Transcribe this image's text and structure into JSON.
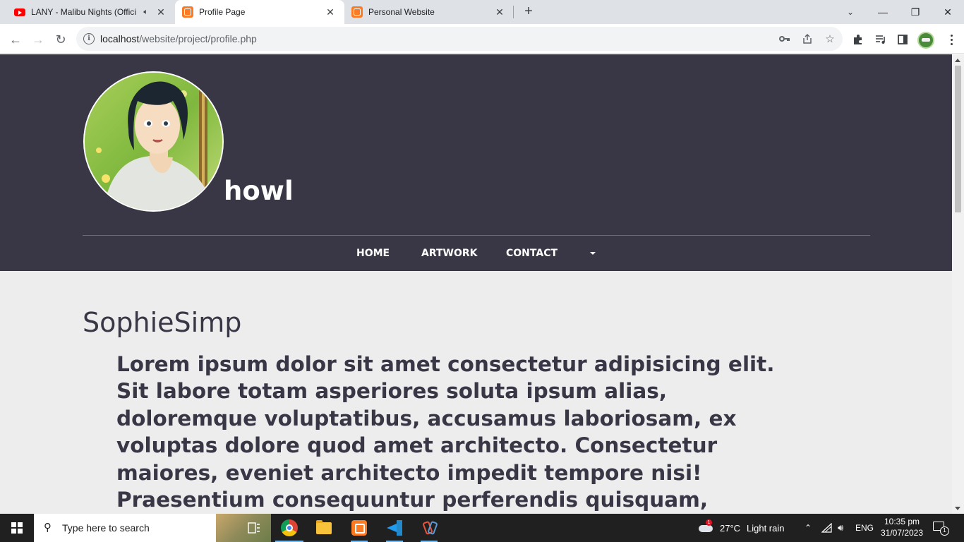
{
  "browser": {
    "tabs": [
      {
        "title": "LANY - Malibu Nights (Offici",
        "favicon": "youtube-icon",
        "audio": true,
        "active": false
      },
      {
        "title": "Profile Page",
        "favicon": "xampp-icon",
        "audio": false,
        "active": true
      },
      {
        "title": "Personal Website",
        "favicon": "xampp-icon",
        "audio": false,
        "active": false
      }
    ],
    "new_tab_symbol": "+",
    "close_symbol": "✕",
    "address": {
      "host": "localhost",
      "path": "/website/project/profile.php"
    },
    "window_controls": {
      "minimize": "—",
      "restore": "❐",
      "close": "✕"
    }
  },
  "page": {
    "username": "howl",
    "nav": {
      "items": [
        "HOME",
        "ARTWORK",
        "CONTACT"
      ]
    },
    "profile_name": "SophieSimp",
    "bio": "Lorem ipsum dolor sit amet consectetur adipisicing elit. Sit labore totam asperiores soluta ipsum alias, doloremque voluptatibus, accusamus laboriosam, ex voluptas dolore quod amet architecto. Consectetur maiores, eveniet architecto impedit tempore nisi! Praesentium consequuntur perferendis quisquam, deserunt nemo facilis voluptates labore maxime consequatur. Voluptate odio alias",
    "colors": {
      "header_bg": "#393746",
      "body_bg": "#ededed",
      "text": "#393746"
    }
  },
  "taskbar": {
    "search_placeholder": "Type here to search",
    "weather": {
      "temp": "27°C",
      "condition": "Light rain",
      "alert_count": "1"
    },
    "language": "ENG",
    "time": "10:35 pm",
    "date": "31/07/2023",
    "notification_count": "1",
    "apps": [
      "task-view-icon",
      "chrome-icon",
      "file-explorer-icon",
      "xampp-icon",
      "vscode-icon",
      "snipping-tool-icon"
    ]
  }
}
